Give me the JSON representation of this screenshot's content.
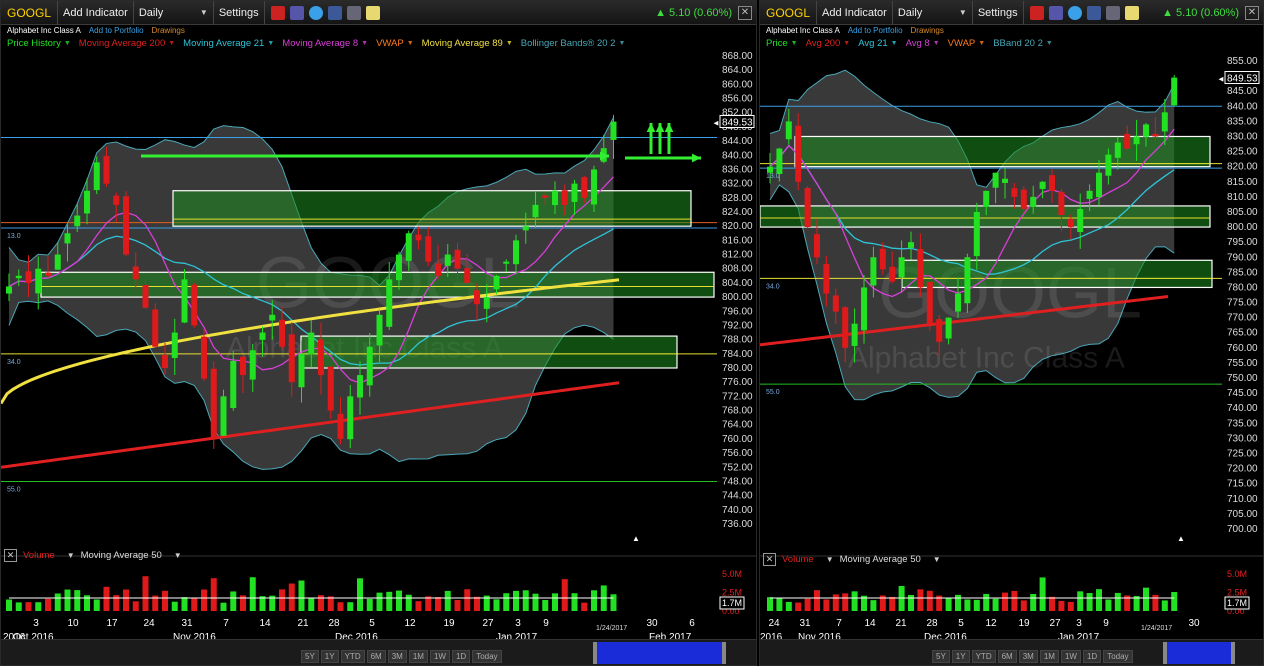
{
  "colors": {
    "up": "#22e022",
    "down": "#e01a1a",
    "ma200": "#e02020",
    "ma21": "#2ec4d8",
    "ma8": "#d83ed8",
    "vwap": "#ff7a1a",
    "ma89": "#f0e040",
    "bb": "#4aa8b8",
    "zone": "#2a8a2a",
    "arrow": "#33ee33"
  },
  "panels": [
    {
      "symbol": "GOOGL",
      "add_indicator": "Add Indicator",
      "interval": "Daily",
      "settings": "Settings",
      "change": "5.10 (0.60%)",
      "company": "Alphabet Inc Class A",
      "add_portfolio": "Add to Portfolio",
      "drawings": "Drawings",
      "indicators": [
        {
          "label": "Price History",
          "color": "#22e022"
        },
        {
          "label": "Moving Average 200",
          "color": "#e02020"
        },
        {
          "label": "Moving Average 21",
          "color": "#2ec4d8"
        },
        {
          "label": "Moving Average 8",
          "color": "#d83ed8"
        },
        {
          "label": "VWAP",
          "color": "#ff7a1a"
        },
        {
          "label": "Moving Average 89",
          "color": "#f0e040"
        },
        {
          "label": "Bollinger Bands® 20 2",
          "color": "#4aa8b8"
        }
      ],
      "watermark": "GOOGL",
      "watermark_sub": "Alphabet Inc Class A",
      "price_ticks": [
        "868.00",
        "864.00",
        "860.00",
        "856.00",
        "852.00",
        "848.00",
        "844.00",
        "840.00",
        "836.00",
        "832.00",
        "828.00",
        "824.00",
        "820.00",
        "816.00",
        "812.00",
        "808.00",
        "804.00",
        "800.00",
        "796.00",
        "792.00",
        "788.00",
        "784.00",
        "780.00",
        "776.00",
        "772.00",
        "768.00",
        "764.00",
        "760.00",
        "756.00",
        "752.00",
        "748.00",
        "744.00",
        "740.00",
        "736.00"
      ],
      "last_price": "849.53",
      "hline_labels": [
        "13.0",
        "34.0",
        "55.0"
      ],
      "volume": "Volume",
      "volume_ma": "Moving Average 50",
      "vol_ticks": [
        "5.0M",
        "2.5M",
        "0.00"
      ],
      "vol_last": "1.7M",
      "date_ticks": [
        "3",
        "10",
        "17",
        "24",
        "31",
        "7",
        "14",
        "21",
        "28",
        "5",
        "12",
        "19",
        "27",
        "3",
        "9",
        "30",
        "6"
      ],
      "months": [
        "Oct 2016",
        "Nov 2016",
        "Dec 2016",
        "Jan 2017",
        "Feb 2017"
      ],
      "month_prefix": "2016",
      "date_marker": "1/24/2017",
      "nav_ranges": [
        "5Y",
        "1Y",
        "YTD",
        "6M",
        "3M",
        "1M",
        "1W",
        "1D",
        "Today"
      ]
    },
    {
      "symbol": "GOOGL",
      "add_indicator": "Add Indicator",
      "interval": "Daily",
      "settings": "Settings",
      "change": "5.10 (0.60%)",
      "company": "Alphabet Inc Class A",
      "add_portfolio": "Add to Portfolio",
      "drawings": "Drawings",
      "indicators": [
        {
          "label": "Price",
          "color": "#22e022"
        },
        {
          "label": "Avg 200",
          "color": "#e02020"
        },
        {
          "label": "Avg 21",
          "color": "#2ec4d8"
        },
        {
          "label": "Avg 8",
          "color": "#d83ed8"
        },
        {
          "label": "VWAP",
          "color": "#ff7a1a"
        },
        {
          "label": "BBand 20 2",
          "color": "#4aa8b8"
        }
      ],
      "watermark": "GOOGL",
      "watermark_sub": "Alphabet Inc Class A",
      "price_ticks": [
        "855.00",
        "850.00",
        "845.00",
        "840.00",
        "835.00",
        "830.00",
        "825.00",
        "820.00",
        "815.00",
        "810.00",
        "805.00",
        "800.00",
        "795.00",
        "790.00",
        "785.00",
        "780.00",
        "775.00",
        "770.00",
        "765.00",
        "760.00",
        "755.00",
        "750.00",
        "745.00",
        "740.00",
        "735.00",
        "730.00",
        "725.00",
        "720.00",
        "715.00",
        "710.00",
        "705.00",
        "700.00"
      ],
      "last_price": "849.53",
      "hline_labels": [
        "13.0",
        "34.0",
        "55.0"
      ],
      "volume": "Volume",
      "volume_ma": "Moving Average 50",
      "vol_ticks": [
        "5.0M",
        "2.5M",
        "0.00"
      ],
      "vol_last": "1.7M",
      "date_ticks": [
        "24",
        "31",
        "7",
        "14",
        "21",
        "28",
        "5",
        "12",
        "19",
        "27",
        "3",
        "9",
        "30"
      ],
      "months": [
        "2016",
        "Nov 2016",
        "Dec 2016",
        "Jan 2017"
      ],
      "date_marker": "1/24/2017",
      "nav_ranges": [
        "5Y",
        "1Y",
        "YTD",
        "6M",
        "3M",
        "1M",
        "1W",
        "1D",
        "Today"
      ]
    }
  ]
}
